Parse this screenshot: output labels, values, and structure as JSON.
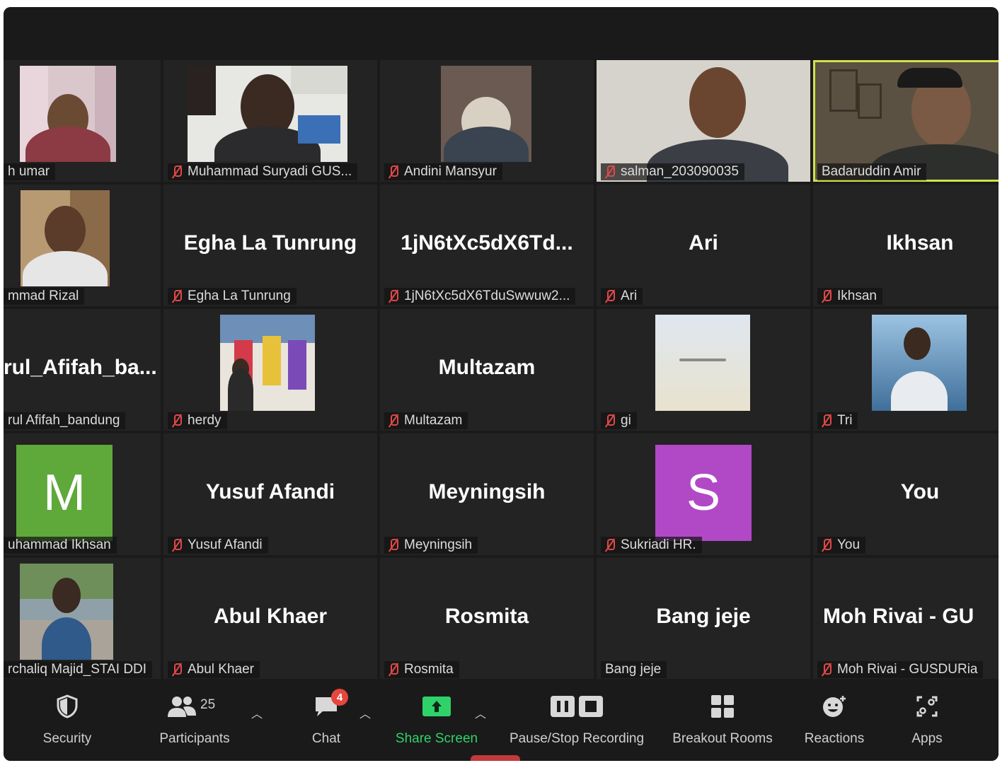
{
  "tiles": [
    {
      "id": "t1",
      "type": "photo",
      "name": "h umar",
      "muted": true
    },
    {
      "id": "t2",
      "type": "photo",
      "name": "Muhammad Suryadi GUS...",
      "muted": true
    },
    {
      "id": "t3",
      "type": "photo",
      "name": "Andini Mansyur",
      "muted": true
    },
    {
      "id": "t4",
      "type": "photo",
      "name": "salman_203090035",
      "muted": true
    },
    {
      "id": "t5",
      "type": "photo",
      "name": "Badaruddin Amir",
      "muted": false,
      "active": true
    },
    {
      "id": "t6",
      "type": "photo",
      "name": "mmad Rizal",
      "muted": false
    },
    {
      "id": "t7",
      "type": "text",
      "display": "Egha La Tunrung",
      "name": "Egha La Tunrung",
      "muted": true
    },
    {
      "id": "t8",
      "type": "text",
      "display": "1jN6tXc5dX6Td...",
      "name": "1jN6tXc5dX6TduSwwuw2...",
      "muted": true
    },
    {
      "id": "t9",
      "type": "text",
      "display": "Ari",
      "name": "Ari",
      "muted": true
    },
    {
      "id": "t10",
      "type": "text",
      "display": "Ikhsan",
      "name": "Ikhsan",
      "muted": true
    },
    {
      "id": "t11",
      "type": "text",
      "display": "rul_Afifah_ba...",
      "name": "rul Afifah_bandung",
      "muted": false
    },
    {
      "id": "t12",
      "type": "photo",
      "name": "herdy",
      "muted": true
    },
    {
      "id": "t13",
      "type": "text",
      "display": "Multazam",
      "name": "Multazam",
      "muted": true
    },
    {
      "id": "t14",
      "type": "photo",
      "name": "gi",
      "muted": true
    },
    {
      "id": "t15",
      "type": "photo",
      "name": "Tri",
      "muted": true
    },
    {
      "id": "t16",
      "type": "letter",
      "letter": "M",
      "letter_color": "#5fa83a",
      "name": "uhammad Ikhsan",
      "muted": false
    },
    {
      "id": "t17",
      "type": "text",
      "display": "Yusuf Afandi",
      "name": "Yusuf Afandi",
      "muted": true
    },
    {
      "id": "t18",
      "type": "text",
      "display": "Meyningsih",
      "name": "Meyningsih",
      "muted": true
    },
    {
      "id": "t19",
      "type": "letter",
      "letter": "S",
      "letter_color": "#b149c6",
      "name": "Sukriadi HR.",
      "muted": true
    },
    {
      "id": "t20",
      "type": "text",
      "display": "You",
      "name": "You",
      "muted": true
    },
    {
      "id": "t21",
      "type": "photo",
      "name": "rchaliq Majid_STAI DDI",
      "muted": false
    },
    {
      "id": "t22",
      "type": "text",
      "display": "Abul Khaer",
      "name": "Abul Khaer",
      "muted": true
    },
    {
      "id": "t23",
      "type": "text",
      "display": "Rosmita",
      "name": "Rosmita",
      "muted": true
    },
    {
      "id": "t24",
      "type": "text",
      "display": "Bang jeje",
      "name": "Bang jeje",
      "muted": false
    },
    {
      "id": "t25",
      "type": "text",
      "display": "Moh Rivai - GU",
      "name": "Moh Rivai - GUSDURia",
      "muted": true
    }
  ],
  "toolbar": {
    "security": "Security",
    "participants": "Participants",
    "participants_count": "25",
    "chat": "Chat",
    "chat_badge": "4",
    "share_screen": "Share Screen",
    "recording": "Pause/Stop Recording",
    "breakout": "Breakout Rooms",
    "reactions": "Reactions",
    "apps": "Apps"
  },
  "colors": {
    "active_speaker": "#cfe24a",
    "share_green": "#2fd26a",
    "badge_red": "#e5463e",
    "mute_red": "#e04848"
  }
}
